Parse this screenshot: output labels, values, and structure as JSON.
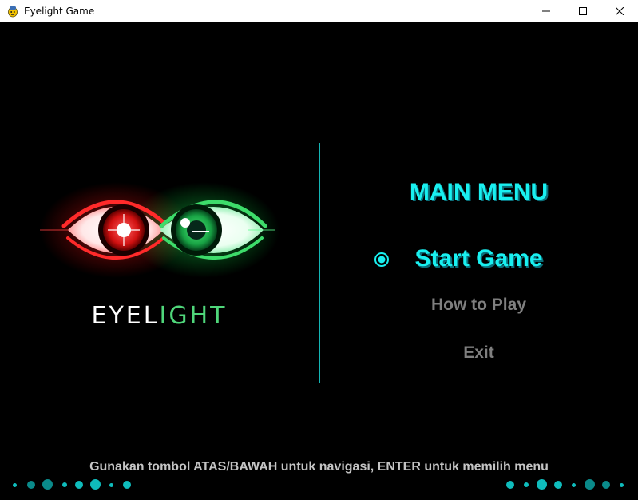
{
  "window": {
    "title": "Eyelight Game"
  },
  "logo": {
    "word_white": "EYEL",
    "word_green": "IGHT"
  },
  "menu": {
    "title": "MAIN MENU",
    "items": [
      {
        "label": "Start Game",
        "selected": true
      },
      {
        "label": "How to Play",
        "selected": false
      },
      {
        "label": "Exit",
        "selected": false
      }
    ]
  },
  "hint": "Gunakan tombol ATAS/BAWAH untuk navigasi, ENTER untuk memilih menu",
  "colors": {
    "accent": "#19f0f0",
    "divider": "#14b4b4",
    "menu_inactive": "#7f7f7f",
    "eye_red": "#ff2a2a",
    "eye_green": "#3ddc6a",
    "logo_green": "#4fd67a"
  },
  "icons": {
    "selector": "radio-selected-icon",
    "logo": "eyes-logo-icon"
  }
}
